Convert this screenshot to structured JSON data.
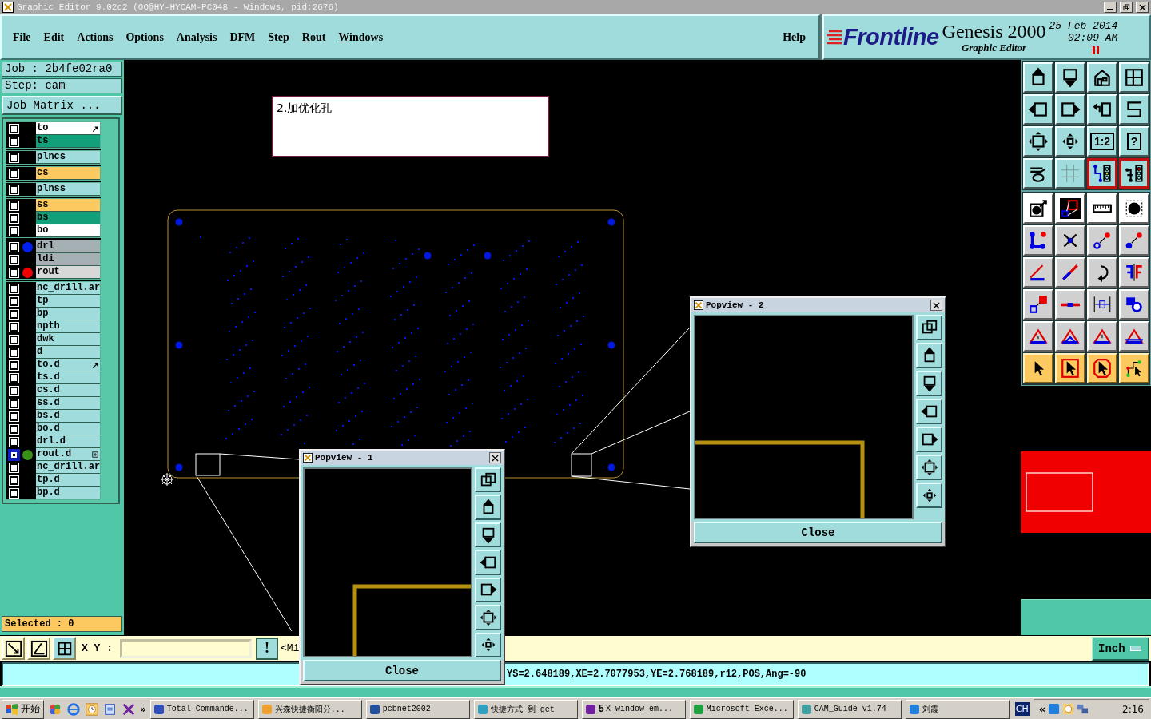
{
  "window": {
    "title": "Graphic Editor 9.02c2 (OO@HY-HYCAM-PC048 - Windows, pid:2676)"
  },
  "menu": [
    {
      "label": "File",
      "mnemonic": true
    },
    {
      "label": "Edit",
      "mnemonic": true
    },
    {
      "label": "Actions",
      "mnemonic": true
    },
    {
      "label": "Options",
      "mnemonic": false
    },
    {
      "label": "Analysis",
      "mnemonic": false
    },
    {
      "label": "DFM",
      "mnemonic": false
    },
    {
      "label": "Step",
      "mnemonic": true
    },
    {
      "label": "Rout",
      "mnemonic": true
    },
    {
      "label": "Windows",
      "mnemonic": true
    }
  ],
  "help_menu": {
    "label": "Help",
    "mnemonic": false
  },
  "brand": {
    "logo": "Frontline",
    "product": "Genesis 2000",
    "subtitle": "Graphic Editor",
    "date": "25 Feb 2014",
    "time": "02:09 AM"
  },
  "job": {
    "job": "Job : 2b4fe02ra0",
    "step": "Step: cam",
    "matrix_button": "Job Matrix ..."
  },
  "layer_groups": [
    {
      "layers": [
        {
          "name": "to",
          "color": "#ffffff",
          "selected": false,
          "tagged": true,
          "expandable": false
        },
        {
          "name": "ts",
          "color": "#11a07a",
          "selected": false,
          "tagged": false,
          "expandable": false
        }
      ]
    },
    {
      "layers": [
        {
          "name": "plncs",
          "color": "#a0dcdc",
          "selected": false,
          "tagged": false,
          "expandable": false
        }
      ]
    },
    {
      "layers": [
        {
          "name": "cs",
          "color": "#fcc860",
          "selected": false,
          "tagged": false,
          "expandable": false
        }
      ]
    },
    {
      "layers": [
        {
          "name": "plnss",
          "color": "#a0dcdc",
          "selected": false,
          "tagged": false,
          "expandable": false
        }
      ]
    },
    {
      "layers": [
        {
          "name": "ss",
          "color": "#fcc860",
          "selected": false,
          "tagged": false,
          "expandable": false
        },
        {
          "name": "bs",
          "color": "#11a07a",
          "selected": false,
          "tagged": false,
          "expandable": false
        },
        {
          "name": "bo",
          "color": "#ffffff",
          "selected": false,
          "tagged": false,
          "expandable": false
        }
      ]
    },
    {
      "layers": [
        {
          "name": "drl",
          "color": "#a4b0b4",
          "selected": false,
          "tagged": false,
          "expandable": false,
          "dot": {
            "color": "#0020f0"
          }
        },
        {
          "name": "ldi",
          "color": "#a4b0b4",
          "selected": false,
          "tagged": false,
          "expandable": false
        },
        {
          "name": "rout",
          "color": "#d8d8d8",
          "selected": false,
          "tagged": false,
          "expandable": false,
          "dot": {
            "color": "#f00000"
          }
        }
      ]
    },
    {
      "layers": [
        {
          "name": "nc_drill.ar",
          "color": "#a0dcdc",
          "selected": false,
          "tagged": false,
          "expandable": false
        },
        {
          "name": "tp",
          "color": "#a0dcdc",
          "selected": false,
          "tagged": false,
          "expandable": false
        },
        {
          "name": "bp",
          "color": "#a0dcdc",
          "selected": false,
          "tagged": false,
          "expandable": false
        },
        {
          "name": "npth",
          "color": "#a0dcdc",
          "selected": false,
          "tagged": false,
          "expandable": false
        },
        {
          "name": "dwk",
          "color": "#a0dcdc",
          "selected": false,
          "tagged": false,
          "expandable": false
        },
        {
          "name": "d",
          "color": "#a0dcdc",
          "selected": false,
          "tagged": false,
          "expandable": false
        },
        {
          "name": "to.d",
          "color": "#a0dcdc",
          "selected": false,
          "tagged": true,
          "expandable": false
        },
        {
          "name": "ts.d",
          "color": "#a0dcdc",
          "selected": false,
          "tagged": false,
          "expandable": false
        },
        {
          "name": "cs.d",
          "color": "#a0dcdc",
          "selected": false,
          "tagged": false,
          "expandable": false
        },
        {
          "name": "ss.d",
          "color": "#a0dcdc",
          "selected": false,
          "tagged": false,
          "expandable": false
        },
        {
          "name": "bs.d",
          "color": "#a0dcdc",
          "selected": false,
          "tagged": false,
          "expandable": false
        },
        {
          "name": "bo.d",
          "color": "#a0dcdc",
          "selected": false,
          "tagged": false,
          "expandable": false
        },
        {
          "name": "drl.d",
          "color": "#a0dcdc",
          "selected": false,
          "tagged": false,
          "expandable": false
        },
        {
          "name": "rout.d",
          "color": "#a0dcdc",
          "selected": true,
          "tagged": false,
          "expandable": true,
          "dot": {
            "color": "#389018"
          }
        },
        {
          "name": "nc_drill.ar",
          "color": "#a0dcdc",
          "selected": false,
          "tagged": false,
          "expandable": false
        },
        {
          "name": "tp.d",
          "color": "#a0dcdc",
          "selected": false,
          "tagged": false,
          "expandable": false
        },
        {
          "name": "bp.d",
          "color": "#a0dcdc",
          "selected": false,
          "tagged": false,
          "expandable": false
        }
      ]
    }
  ],
  "selected_count": "Selected : 0",
  "canvas": {
    "note": "2.加优化孔"
  },
  "popviews": [
    {
      "title": "Popview - 2",
      "close": "Close"
    },
    {
      "title": "Popview - 1",
      "close": "Close"
    }
  ],
  "tools": [
    {
      "on": false
    },
    {
      "on": false
    },
    {
      "on": false
    },
    {
      "on": false
    },
    {
      "on": false
    },
    {
      "on": false
    },
    {
      "on": false
    },
    {
      "on": false
    },
    {
      "on": false
    },
    {
      "on": false
    },
    {
      "on": false,
      "label": "1:2"
    },
    {
      "on": false,
      "label": "?"
    },
    {
      "on": false
    },
    {
      "on": false
    },
    {
      "on": true
    },
    {
      "on": true
    },
    {
      "on": false
    },
    {
      "on": false
    },
    {
      "on": false
    },
    {
      "on": false
    },
    {
      "on": false
    },
    {
      "on": false
    },
    {
      "on": false
    },
    {
      "on": false
    },
    {
      "on": false
    },
    {
      "on": false
    },
    {
      "on": false
    },
    {
      "on": false
    },
    {
      "on": false
    },
    {
      "on": false
    },
    {
      "on": false
    },
    {
      "on": false
    },
    {
      "on": false
    },
    {
      "on": false
    },
    {
      "on": false
    },
    {
      "on": false
    },
    {
      "on": false
    },
    {
      "on": false
    },
    {
      "on": false
    },
    {
      "on": false
    }
  ],
  "command_bar": {
    "xy_label": "X Y :",
    "warn": "!",
    "prompt": "<M1",
    "units": "Inch"
  },
  "status": "YS=2.648189,XE=2.7077953,YE=2.768189,r12,POS,Ang=-90",
  "taskbar": {
    "start": "开始",
    "more": "»",
    "tasks": [
      {
        "label": "Total Commande..."
      },
      {
        "label": "兴森快捷衡阳分..."
      },
      {
        "label": "pcbnet2002"
      },
      {
        "label": "快捷方式 到 get"
      },
      {
        "count": "5",
        "label": "X window em..."
      },
      {
        "label": "Microsoft Exce..."
      },
      {
        "label": "CAM_Guide v1.74"
      },
      {
        "label": "刘霞"
      }
    ],
    "lang": "CH",
    "expand": "«",
    "clock": "2:16"
  }
}
